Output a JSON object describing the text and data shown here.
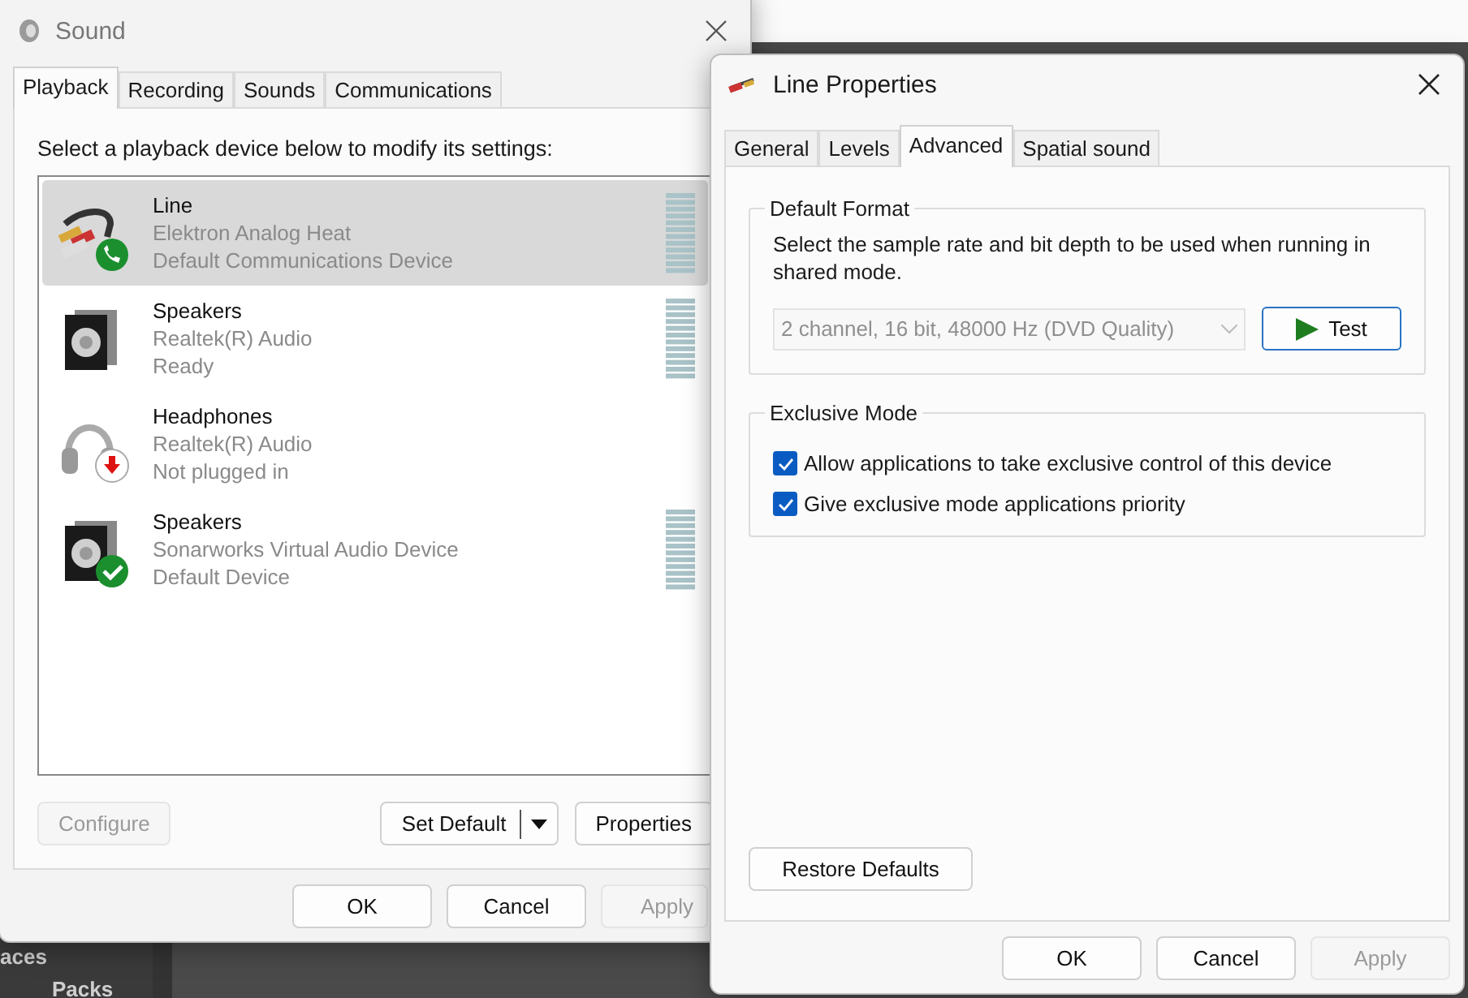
{
  "background": {
    "texts": [
      "aces",
      "Packs"
    ]
  },
  "sound_window": {
    "title": "Sound",
    "tabs": [
      {
        "label": "Playback",
        "selected": true
      },
      {
        "label": "Recording",
        "selected": false
      },
      {
        "label": "Sounds",
        "selected": false
      },
      {
        "label": "Communications",
        "selected": false
      }
    ],
    "instruction": "Select a playback device below to modify its settings:",
    "devices": [
      {
        "kind": "line",
        "name": "Line",
        "description": "Elektron Analog Heat",
        "status": "Default Communications Device",
        "communications_default": true,
        "default": false,
        "unplugged": false,
        "meter": true,
        "selected": true
      },
      {
        "kind": "speakers",
        "name": "Speakers",
        "description": "Realtek(R) Audio",
        "status": "Ready",
        "communications_default": false,
        "default": false,
        "unplugged": false,
        "meter": true,
        "selected": false
      },
      {
        "kind": "headphones",
        "name": "Headphones",
        "description": "Realtek(R) Audio",
        "status": "Not plugged in",
        "communications_default": false,
        "default": false,
        "unplugged": true,
        "meter": false,
        "selected": false
      },
      {
        "kind": "speakers",
        "name": "Speakers",
        "description": "Sonarworks Virtual Audio Device",
        "status": "Default Device",
        "communications_default": false,
        "default": true,
        "unplugged": false,
        "meter": true,
        "selected": false
      }
    ],
    "configure_button": {
      "label": "Configure",
      "disabled": true
    },
    "set_default_button": {
      "label": "Set Default"
    },
    "properties_button": {
      "label": "Properties",
      "disabled": false
    },
    "footer_buttons": [
      {
        "label": "OK",
        "disabled": false
      },
      {
        "label": "Cancel",
        "disabled": false
      },
      {
        "label": "Apply",
        "disabled": true
      }
    ]
  },
  "properties_window": {
    "title": "Line Properties",
    "tabs": [
      {
        "label": "General",
        "selected": false
      },
      {
        "label": "Levels",
        "selected": false
      },
      {
        "label": "Advanced",
        "selected": true
      },
      {
        "label": "Spatial sound",
        "selected": false
      }
    ],
    "default_format": {
      "title": "Default Format",
      "description": "Select the sample rate and bit depth to be used when running in shared mode.",
      "format": {
        "value": "2 channel, 16 bit, 48000 Hz (DVD Quality)",
        "disabled": true
      },
      "test_button": "Test"
    },
    "exclusive_mode": {
      "title": "Exclusive Mode",
      "options": [
        {
          "label": "Allow applications to take exclusive control of this device",
          "checked": true
        },
        {
          "label": "Give exclusive mode applications priority",
          "checked": true
        }
      ]
    },
    "restore_button": "Restore Defaults",
    "footer_buttons": [
      {
        "label": "OK",
        "disabled": false
      },
      {
        "label": "Cancel",
        "disabled": false
      },
      {
        "label": "Apply",
        "disabled": true
      }
    ]
  }
}
